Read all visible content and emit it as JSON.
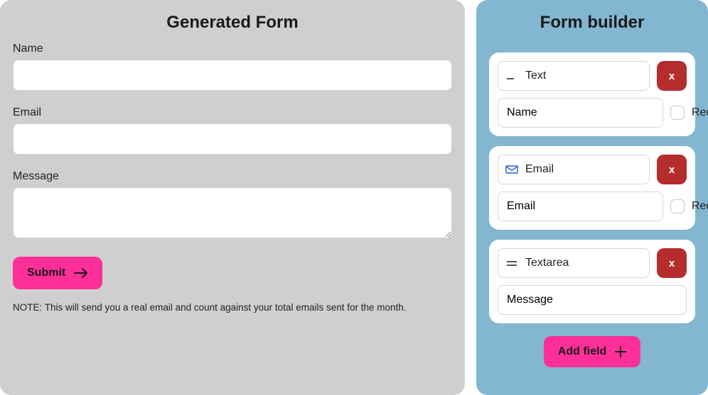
{
  "left": {
    "title": "Generated Form",
    "fields": [
      {
        "label": "Name",
        "value": ""
      },
      {
        "label": "Email",
        "value": ""
      },
      {
        "label": "Message",
        "value": ""
      }
    ],
    "submit_label": "Submit",
    "note": "NOTE: This will send you a real email and count against your total emails sent for the month."
  },
  "right": {
    "title": "Form builder",
    "required_label": "Required",
    "delete_label": "x",
    "add_field_label": "Add field",
    "cards": [
      {
        "type_label": "Text",
        "label_value": "Name",
        "show_required": true
      },
      {
        "type_label": "Email",
        "label_value": "Email",
        "show_required": true
      },
      {
        "type_label": "Textarea",
        "label_value": "Message",
        "show_required": false
      }
    ]
  },
  "icons": {
    "text": "_",
    "textarea": "="
  }
}
